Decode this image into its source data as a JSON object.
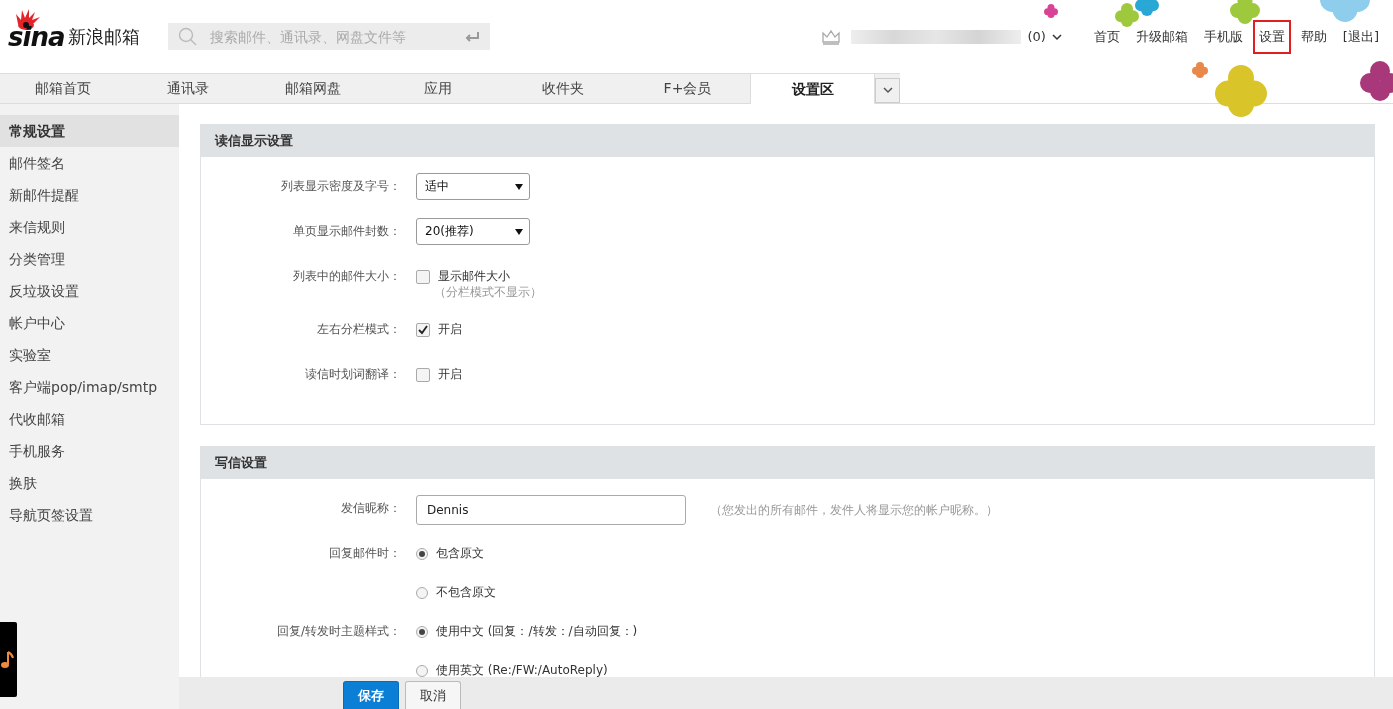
{
  "header": {
    "logo_text": "sina",
    "product_name": "新浪邮箱",
    "search": {
      "placeholder": "搜索邮件、通讯录、网盘文件等"
    },
    "account_count": "(0)",
    "links": [
      {
        "label": "首页",
        "selected": false
      },
      {
        "label": "升级邮箱",
        "selected": false
      },
      {
        "label": "手机版",
        "selected": false
      },
      {
        "label": "设置",
        "selected": true
      },
      {
        "label": "帮助",
        "selected": false
      },
      {
        "label": "[退出]",
        "selected": false
      }
    ]
  },
  "tabs": [
    {
      "label": "邮箱首页",
      "selected": false
    },
    {
      "label": "通讯录",
      "selected": false
    },
    {
      "label": "邮箱网盘",
      "selected": false
    },
    {
      "label": "应用",
      "selected": false
    },
    {
      "label": "收件夹",
      "selected": false
    },
    {
      "label": "F+会员",
      "selected": false
    },
    {
      "label": "设置区",
      "selected": true
    }
  ],
  "sidebar": {
    "items": [
      {
        "label": "常规设置",
        "selected": true
      },
      {
        "label": "邮件签名",
        "selected": false
      },
      {
        "label": "新邮件提醒",
        "selected": false
      },
      {
        "label": "来信规则",
        "selected": false
      },
      {
        "label": "分类管理",
        "selected": false
      },
      {
        "label": "反垃圾设置",
        "selected": false
      },
      {
        "label": "帐户中心",
        "selected": false
      },
      {
        "label": "实验室",
        "selected": false
      },
      {
        "label": "客户端pop/imap/smtp",
        "selected": false
      },
      {
        "label": "代收邮箱",
        "selected": false
      },
      {
        "label": "手机服务",
        "selected": false
      },
      {
        "label": "换肤",
        "selected": false
      },
      {
        "label": "导航页签设置",
        "selected": false
      }
    ]
  },
  "sections": [
    {
      "title": "读信显示设置",
      "rows": [
        {
          "kind": "select",
          "label": "列表显示密度及字号：",
          "value": "适中"
        },
        {
          "kind": "select",
          "label": "单页显示邮件封数：",
          "value": "20(推荐)"
        },
        {
          "kind": "checkbox",
          "label": "列表中的邮件大小：",
          "option": "显示邮件大小",
          "checked": false,
          "note": "（分栏模式不显示）"
        },
        {
          "kind": "checkbox",
          "label": "左右分栏模式：",
          "option": "开启",
          "checked": true
        },
        {
          "kind": "checkbox",
          "label": "读信时划词翻译：",
          "option": "开启",
          "checked": false
        }
      ]
    },
    {
      "title": "写信设置",
      "rows": [
        {
          "kind": "text",
          "label": "发信昵称：",
          "value": "Dennis",
          "hint": "（您发出的所有邮件，发件人将显示您的帐户昵称。）"
        },
        {
          "kind": "radio",
          "label": "回复邮件时：",
          "options": [
            {
              "label": "包含原文",
              "selected": true
            },
            {
              "label": "不包含原文",
              "selected": false
            }
          ]
        },
        {
          "kind": "radio",
          "label": "回复/转发时主题样式：",
          "options": [
            {
              "label": "使用中文 (回复：/转发：/自动回复：)",
              "selected": true
            },
            {
              "label": "使用英文 (Re:/FW:/AutoReply)",
              "selected": false
            }
          ]
        }
      ]
    }
  ],
  "footer": {
    "buttons": [
      {
        "label": "保存",
        "kind": "primary"
      },
      {
        "label": "取消",
        "kind": "default"
      }
    ]
  }
}
